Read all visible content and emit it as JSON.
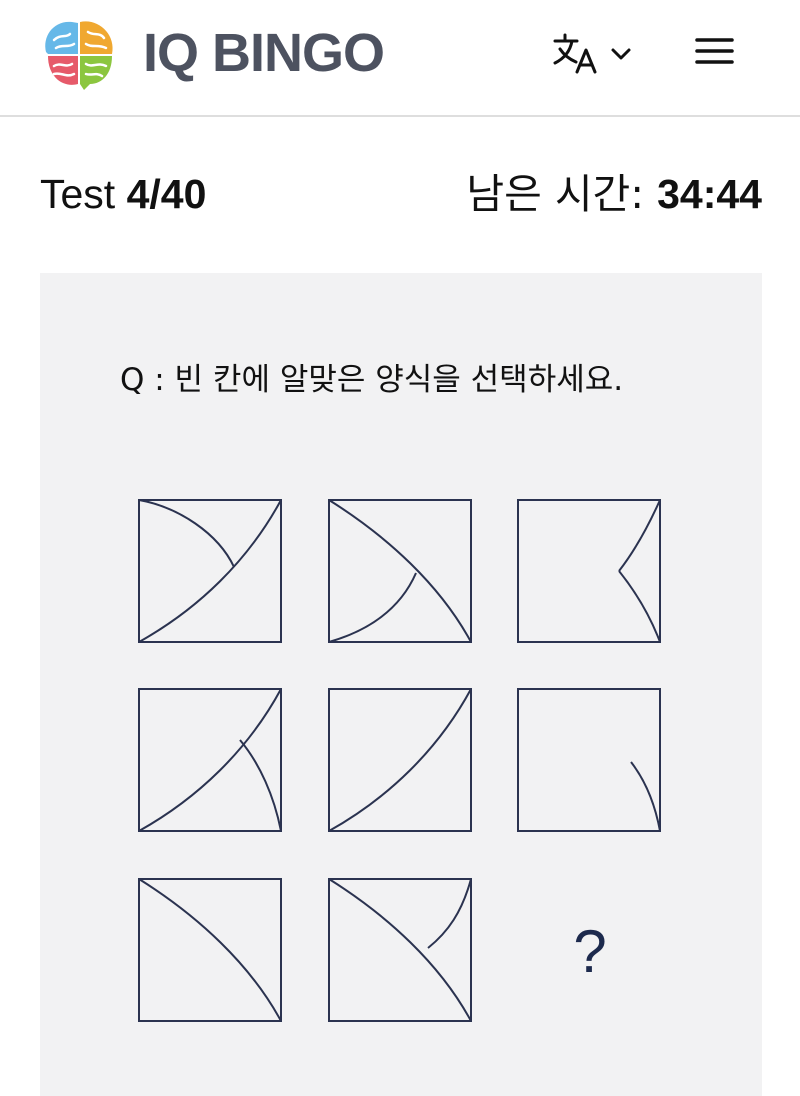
{
  "header": {
    "brand": "IQ BINGO",
    "logo_icon": "brain-logo-icon",
    "language_icon": "translate-icon",
    "language_chevron_icon": "chevron-down-icon",
    "menu_icon": "hamburger-menu-icon",
    "logo_colors": [
      "#66b8e8",
      "#f0a830",
      "#e65a6a",
      "#8cc63f"
    ]
  },
  "status": {
    "test_prefix": "Test",
    "test_progress": "4/40",
    "time_label": "남은 시간:",
    "time_value": "34:44"
  },
  "question": {
    "text": "Q : 빈 칸에 알맞은 양식을 선택하세요.",
    "missing_cell_symbol": "?"
  },
  "colors": {
    "line": "#2b3350",
    "card_bg": "#f2f2f3",
    "brand_text": "#4d5260",
    "question_mark": "#1d2a4d"
  }
}
